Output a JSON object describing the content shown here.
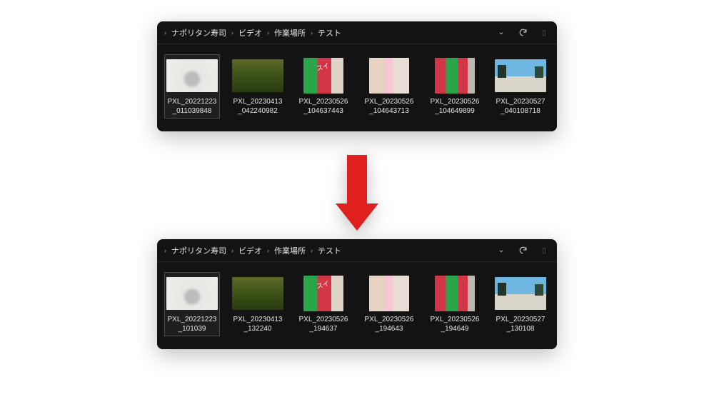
{
  "breadcrumb": {
    "items": [
      "ナポリタン寿司",
      "ビデオ",
      "作業場所",
      "テスト"
    ]
  },
  "top_window": {
    "files": [
      {
        "name": "PXL_20221223_011039848",
        "thumb_class": "th1",
        "wide": true,
        "selected": true
      },
      {
        "name": "PXL_20230413_042240982",
        "thumb_class": "th2",
        "wide": true
      },
      {
        "name": "PXL_20230526_104637443",
        "thumb_class": "th3"
      },
      {
        "name": "PXL_20230526_104643713",
        "thumb_class": "th4"
      },
      {
        "name": "PXL_20230526_104649899",
        "thumb_class": "th5"
      },
      {
        "name": "PXL_20230527_040108718",
        "thumb_class": "th6",
        "wide": true
      }
    ]
  },
  "bottom_window": {
    "files": [
      {
        "name": "PXL_20221223_101039",
        "thumb_class": "th1",
        "wide": true,
        "selected": true
      },
      {
        "name": "PXL_20230413_132240",
        "thumb_class": "th2",
        "wide": true
      },
      {
        "name": "PXL_20230526_194637",
        "thumb_class": "th3"
      },
      {
        "name": "PXL_20230526_194643",
        "thumb_class": "th4"
      },
      {
        "name": "PXL_20230526_194649",
        "thumb_class": "th5"
      },
      {
        "name": "PXL_20230527_130108",
        "thumb_class": "th6",
        "wide": true
      }
    ]
  }
}
